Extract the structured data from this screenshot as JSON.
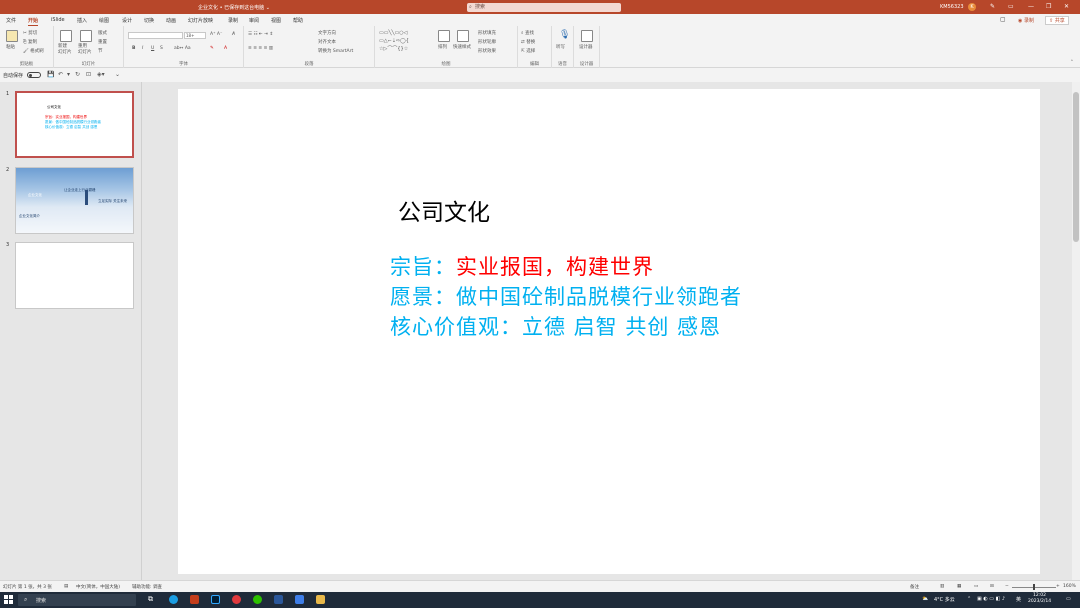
{
  "titlebar": {
    "title": "企业文化 • 已保存到这台电脑 ⌄",
    "search_placeholder": "搜索",
    "user": "KM56323",
    "avatar": "K"
  },
  "tabs": [
    "文件",
    "开始",
    "iSlide",
    "插入",
    "绘图",
    "设计",
    "切换",
    "动画",
    "幻灯片放映",
    "录制",
    "审阅",
    "视图",
    "帮助"
  ],
  "active_tab": "开始",
  "tabs_right": {
    "record": "◉ 录制",
    "share": "⇪ 共享"
  },
  "ribbon": {
    "clipboard": {
      "paste": "粘贴",
      "cut": "剪切",
      "copy": "复制",
      "format_painter": "格式刷",
      "label": "剪贴板"
    },
    "slides": {
      "new_slide": "新建\n幻灯片",
      "reuse": "重用\n幻灯片",
      "layout": "版式",
      "reset": "重置",
      "section": "节",
      "label": "幻灯片"
    },
    "font": {
      "font_name": "",
      "font_size": "18+",
      "bold": "B",
      "italic": "I",
      "underline": "U",
      "strike": "S",
      "label": "字体"
    },
    "paragraph": {
      "text_direction": "文字方向",
      "align_text": "对齐文本",
      "smartart": "转换为 SmartArt",
      "label": "段落"
    },
    "drawing": {
      "arrange": "排列",
      "quick_styles": "快速样式",
      "fill": "形状填充",
      "outline": "形状轮廓",
      "effects": "形状效果",
      "label": "绘图"
    },
    "editing": {
      "find": "查找",
      "replace": "替换",
      "select": "选择",
      "label": "编辑"
    },
    "voice": {
      "dictate": "听写",
      "label": "语音"
    },
    "designer": {
      "designer": "设计器",
      "label": "设计器"
    }
  },
  "qat": {
    "autosave": "自动保存"
  },
  "thumbnails": [
    {
      "num": "1",
      "title": "公司文化",
      "l1": "宗旨：实业报国，构建世界",
      "l2": "愿景：做中国砼制品脱模行业领跑者",
      "l3": "核心价值观：立德 启智 共创 感恩"
    },
    {
      "num": "2",
      "t_a": "企业文化",
      "t_b": "让企业走上行业巅峰",
      "t_c": "企业文化简介",
      "t_d": "立足实际 关注未来"
    },
    {
      "num": "3"
    }
  ],
  "slide": {
    "title": "公司文化",
    "mission_label": "宗旨：",
    "mission_text": "实业报国，构建世界",
    "vision": "愿景：做中国砼制品脱模行业领跑者",
    "values": "核心价值观：立德 启智 共创 感恩",
    "colors": {
      "label": "#00b0f0",
      "mission": "#ff0000",
      "title": "#000000"
    }
  },
  "statusbar": {
    "slide_count": "幻灯片 第 1 张，共 3 张",
    "language": "中文(简体，中国大陆)",
    "accessibility": "辅助功能: 调查",
    "notes": "备注",
    "zoom": "160%"
  },
  "taskbar": {
    "search": "搜索",
    "weather": "4°C 多云",
    "ime": "英",
    "time": "12:02",
    "date": "2023/2/14"
  }
}
